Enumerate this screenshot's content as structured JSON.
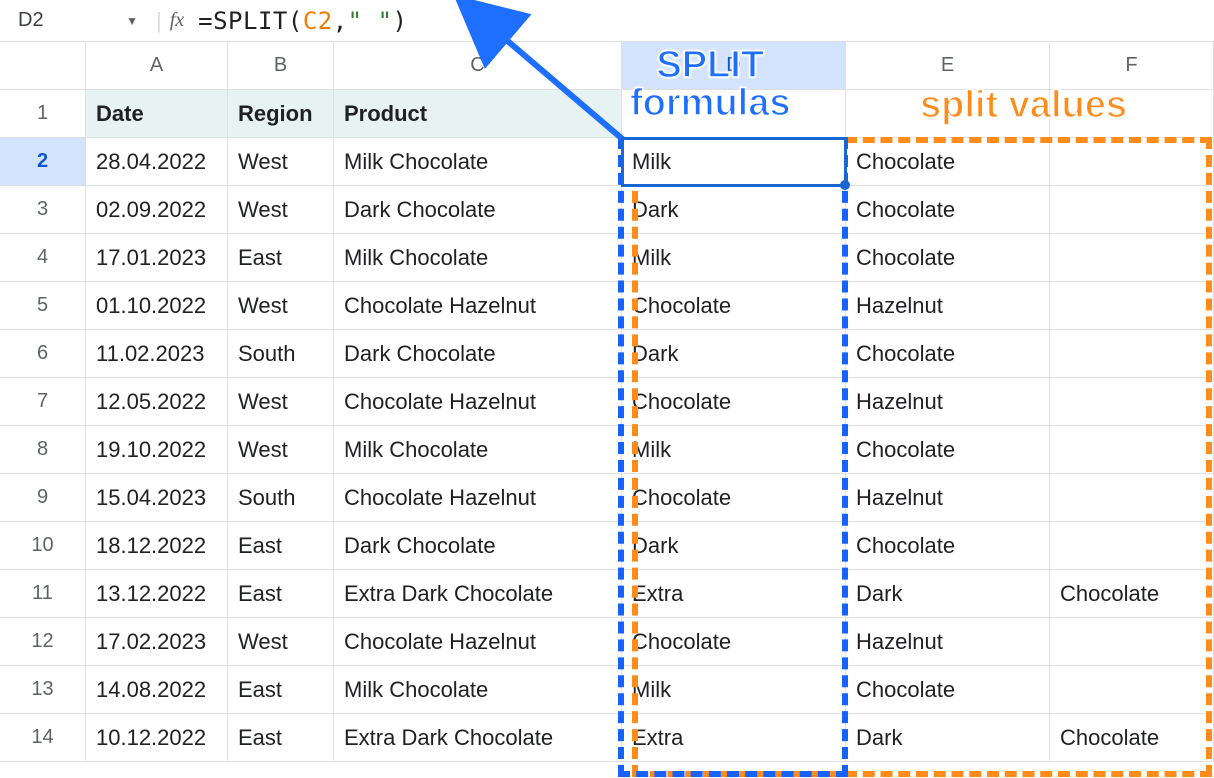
{
  "nameBox": "D2",
  "formulaParts": {
    "p1": "=SPLIT(",
    "ref": "C2",
    "p2": ",",
    "lit": "\" \"",
    "p3": ")"
  },
  "columns": [
    "A",
    "B",
    "C",
    "D",
    "E",
    "F"
  ],
  "headerRow": {
    "A": "Date",
    "B": "Region",
    "C": "Product",
    "D": "",
    "E": "",
    "F": ""
  },
  "rows": [
    {
      "n": "1"
    },
    {
      "n": "2",
      "A": "28.04.2022",
      "B": "West",
      "C": "Milk Chocolate",
      "D": "Milk",
      "E": "Chocolate",
      "F": ""
    },
    {
      "n": "3",
      "A": "02.09.2022",
      "B": "West",
      "C": "Dark Chocolate",
      "D": "Dark",
      "E": "Chocolate",
      "F": ""
    },
    {
      "n": "4",
      "A": "17.01.2023",
      "B": "East",
      "C": "Milk Chocolate",
      "D": "Milk",
      "E": "Chocolate",
      "F": ""
    },
    {
      "n": "5",
      "A": "01.10.2022",
      "B": "West",
      "C": "Chocolate Hazelnut",
      "D": "Chocolate",
      "E": "Hazelnut",
      "F": ""
    },
    {
      "n": "6",
      "A": "11.02.2023",
      "B": "South",
      "C": "Dark Chocolate",
      "D": "Dark",
      "E": "Chocolate",
      "F": ""
    },
    {
      "n": "7",
      "A": "12.05.2022",
      "B": "West",
      "C": "Chocolate Hazelnut",
      "D": "Chocolate",
      "E": "Hazelnut",
      "F": ""
    },
    {
      "n": "8",
      "A": "19.10.2022",
      "B": "West",
      "C": "Milk Chocolate",
      "D": "Milk",
      "E": "Chocolate",
      "F": ""
    },
    {
      "n": "9",
      "A": "15.04.2023",
      "B": "South",
      "C": "Chocolate Hazelnut",
      "D": "Chocolate",
      "E": "Hazelnut",
      "F": ""
    },
    {
      "n": "10",
      "A": "18.12.2022",
      "B": "East",
      "C": "Dark Chocolate",
      "D": "Dark",
      "E": "Chocolate",
      "F": ""
    },
    {
      "n": "11",
      "A": "13.12.2022",
      "B": "East",
      "C": "Extra Dark Chocolate",
      "D": "Extra",
      "E": "Dark",
      "F": "Chocolate"
    },
    {
      "n": "12",
      "A": "17.02.2023",
      "B": "West",
      "C": "Chocolate Hazelnut",
      "D": "Chocolate",
      "E": "Hazelnut",
      "F": ""
    },
    {
      "n": "13",
      "A": "14.08.2022",
      "B": "East",
      "C": "Milk Chocolate",
      "D": "Milk",
      "E": "Chocolate",
      "F": ""
    },
    {
      "n": "14",
      "A": "10.12.2022",
      "B": "East",
      "C": "Extra Dark Chocolate",
      "D": "Extra",
      "E": "Dark",
      "F": "Chocolate"
    }
  ],
  "annotations": {
    "blueLabel": "SPLIT\nformulas",
    "orangeLabel": "split values"
  },
  "activeCell": "D2"
}
